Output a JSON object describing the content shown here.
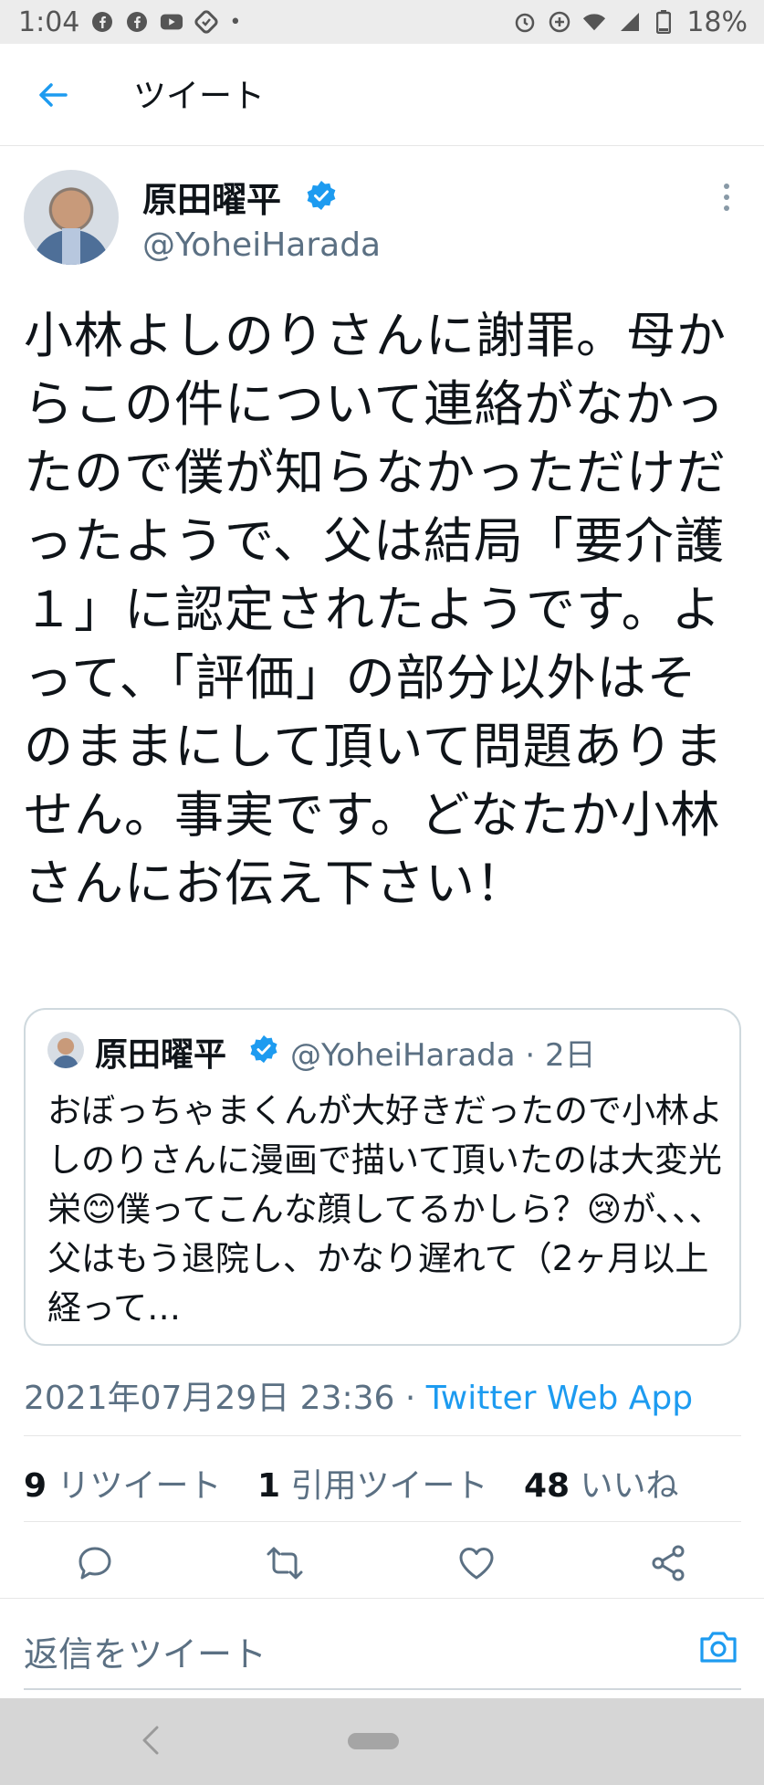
{
  "status_bar": {
    "time": "1:04",
    "battery": "18%",
    "dot": "•"
  },
  "header": {
    "title": "ツイート"
  },
  "tweet": {
    "author_name": "原田曜平",
    "author_handle": "@YoheiHarada",
    "text": "小林よしのりさんに謝罪。母からこの件について連絡がなかったので僕が知らなかっただけだったようで、父は結局「要介護１」に認定されたようです。よって、「評価」の部分以外はそのままにして頂いて問題ありません。事実です。どなたか小林さんにお伝え下さい！",
    "quote": {
      "author_name": "原田曜平",
      "author_handle": "@YoheiHarada · 2日",
      "text": "おぼっちゃまくんが大好きだったので小林よしのりさんに漫画で描いて頂いたのは大変光栄😊僕ってこんな顔してるかしら？😢が、、、父はもう退院し、かなり遅れて（2ヶ月以上経って…"
    },
    "timestamp": "2021年07月29日 23:36 · ",
    "source": "Twitter Web App",
    "stats": {
      "retweets_count": "9",
      "retweets_label": "リツイート",
      "quotes_count": "1",
      "quotes_label": "引用ツイート",
      "likes_count": "48",
      "likes_label": "いいね"
    }
  },
  "reply": {
    "placeholder": "返信をツイート"
  },
  "colors": {
    "accent": "#1d9bf0",
    "secondary_text": "#5b7083",
    "border": "#cfd9de"
  },
  "icons": [
    "back-arrow-icon",
    "verified-badge-icon",
    "more-icon",
    "reply-icon",
    "retweet-icon",
    "like-icon",
    "share-icon",
    "camera-icon"
  ]
}
